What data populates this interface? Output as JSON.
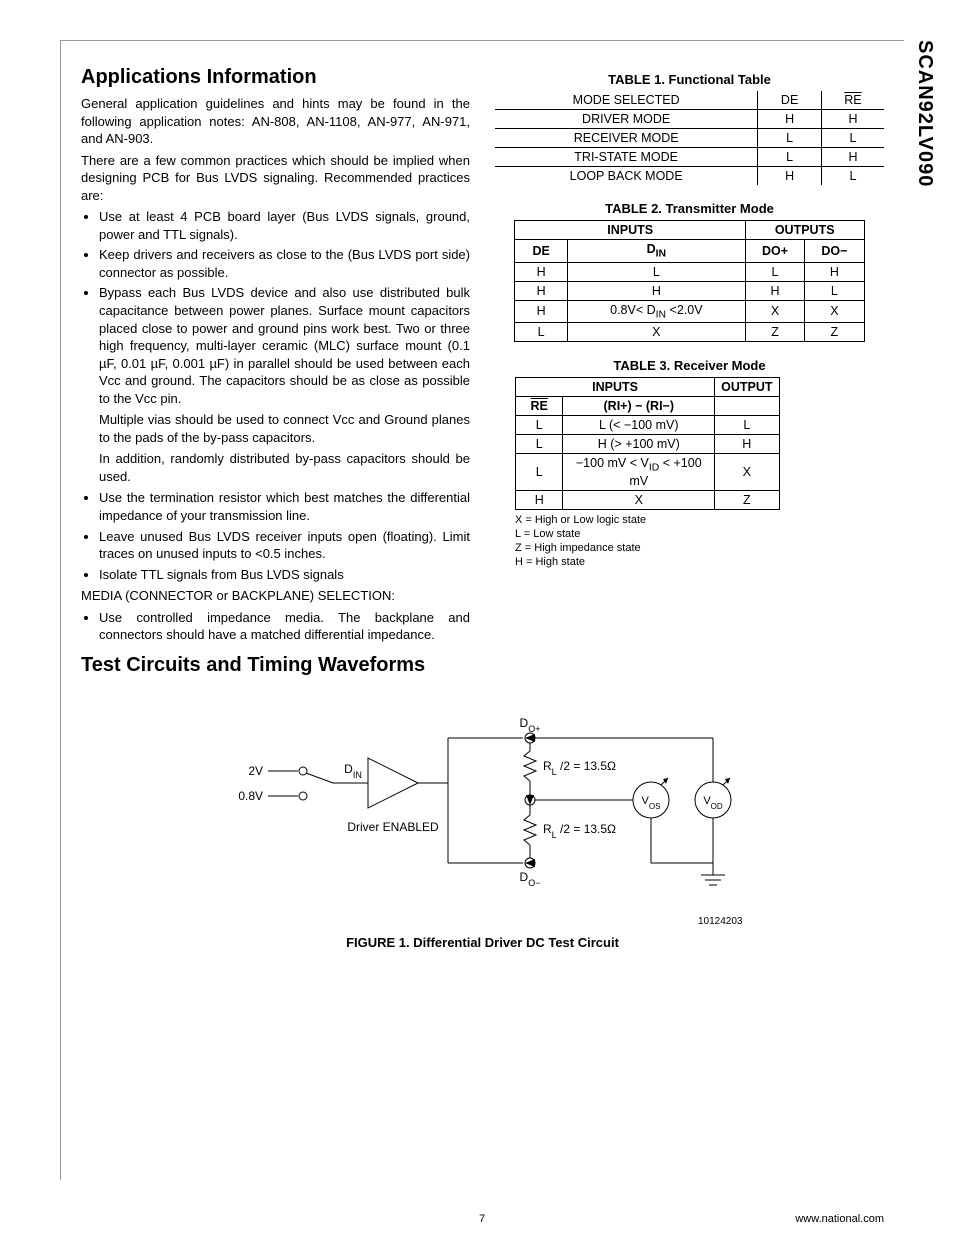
{
  "part_number": "SCAN92LV090",
  "section1_title": "Applications Information",
  "intro_p1": "General application guidelines and hints may be found in the following application notes: AN-808, AN-1108, AN-977, AN-971, and AN-903.",
  "intro_p2": "There are a few common practices which should be implied when designing PCB for Bus LVDS signaling. Recommended practices are:",
  "bullets": {
    "b1": "Use at least 4 PCB board layer (Bus LVDS signals, ground, power and TTL signals).",
    "b2": "Keep drivers and receivers as close to the (Bus LVDS port side) connector as possible.",
    "b3": "Bypass each Bus LVDS device and also use distributed bulk capacitance between power planes. Surface mount capacitors placed close to power and ground pins work best. Two or three high frequency, multi-layer ceramic (MLC) surface mount (0.1 µF, 0.01 µF, 0.001 µF) in parallel should be used between each Vᴄᴄ and ground. The capacitors should be as close as possible to the Vᴄᴄ pin.",
    "b3_s1": "Multiple vias should be used to connect Vᴄᴄ and Ground planes to the pads of the by-pass capacitors.",
    "b3_s2": "In addition, randomly distributed by-pass capacitors should be used.",
    "b4": "Use the termination resistor which best matches the differential impedance of your transmission line.",
    "b5": "Leave unused Bus LVDS receiver inputs open (floating). Limit traces on unused inputs to <0.5 inches.",
    "b6": "Isolate TTL signals from Bus LVDS signals"
  },
  "media_line": "MEDIA (CONNECTOR or BACKPLANE) SELECTION:",
  "b7": "Use controlled impedance media. The backplane and connectors should have a matched differential impedance.",
  "section2_title": "Test Circuits and Timing Waveforms",
  "table1": {
    "title": "TABLE 1. Functional Table",
    "headers": [
      "MODE SELECTED",
      "DE",
      "RE"
    ],
    "rows": [
      [
        "DRIVER MODE",
        "H",
        "H"
      ],
      [
        "RECEIVER MODE",
        "L",
        "L"
      ],
      [
        "TRI-STATE MODE",
        "L",
        "H"
      ],
      [
        "LOOP BACK MODE",
        "H",
        "L"
      ]
    ]
  },
  "table2": {
    "title": "TABLE 2. Transmitter Mode",
    "group_inputs": "INPUTS",
    "group_outputs": "OUTPUTS",
    "headers": [
      "DE",
      "D_IN",
      "DO+",
      "DO−"
    ],
    "rows": [
      [
        "H",
        "L",
        "L",
        "H"
      ],
      [
        "H",
        "H",
        "H",
        "L"
      ],
      [
        "H",
        "0.8V< D_IN <2.0V",
        "X",
        "X"
      ],
      [
        "L",
        "X",
        "Z",
        "Z"
      ]
    ]
  },
  "table3": {
    "title": "TABLE 3. Receiver Mode",
    "group_inputs": "INPUTS",
    "group_output": "OUTPUT",
    "headers": [
      "RE",
      "(RI+) − (RI−)"
    ],
    "rows": [
      [
        "L",
        "L (< −100 mV)",
        "L"
      ],
      [
        "L",
        "H (> +100 mV)",
        "H"
      ],
      [
        "L",
        "−100 mV < V_ID < +100 mV",
        "X"
      ],
      [
        "H",
        "X",
        "Z"
      ]
    ]
  },
  "legend": {
    "x": "X = High or Low logic state",
    "l": "L = Low state",
    "z": "Z = High impedance state",
    "h": "H = High state"
  },
  "figure": {
    "caption": "FIGURE 1. Differential Driver DC Test Circuit",
    "id": "10124203",
    "labels": {
      "v2": "2V",
      "v08": "0.8V",
      "din": "D_IN",
      "drv_en": "Driver ENABLED",
      "dop": "D_O+",
      "dom": "D_O−",
      "r1": "R_L /2  =  13.5Ω",
      "r2": "R_L /2  =  13.5Ω",
      "vos": "V_OS",
      "vod": "V_OD"
    }
  },
  "footer": {
    "page": "7",
    "url": "www.national.com"
  }
}
